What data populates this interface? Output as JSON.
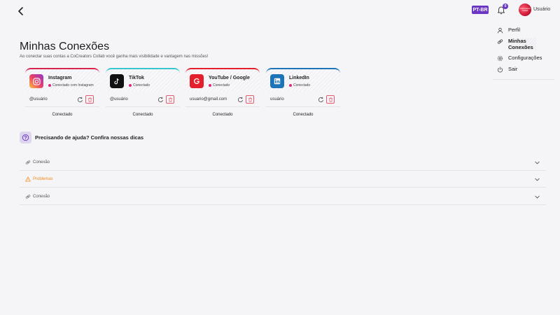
{
  "header": {
    "language": "PT-BR",
    "notifications_count": "0",
    "avatar_text": "CoCreators Collab",
    "user_name": "Usuário"
  },
  "menu": {
    "items": [
      {
        "label": "Perfil",
        "icon": "user-icon"
      },
      {
        "label": "Minhas Conexões",
        "icon": "link-icon"
      },
      {
        "label": "Configurações",
        "icon": "gear-icon"
      },
      {
        "label": "Sair",
        "icon": "power-icon"
      }
    ]
  },
  "page": {
    "title": "Minhas Conexões",
    "subtitle": "Ao conectar suas contas a CoCreators Collab você ganha mais visibilidade e vantagem nas missões!"
  },
  "connections": [
    {
      "name": "Instagram",
      "status": "Conectado com Instagram",
      "handle": "@usuário",
      "label": "Conectado",
      "color": "#d8244c"
    },
    {
      "name": "TikTok",
      "status": "Conectado",
      "handle": "@usuário",
      "label": "Conectado",
      "color": "#38c5cf"
    },
    {
      "name": "YouTube / Google",
      "status": "Conectado",
      "handle": "usuario@gmail.com",
      "label": "Conectado",
      "color": "#e41e2b"
    },
    {
      "name": "LinkedIn",
      "status": "Conectado",
      "handle": "usuário",
      "label": "Conectado",
      "color": "#1d74b6"
    }
  ],
  "help": {
    "title": "Precisando de ajuda? Confira nossas dicas",
    "items": [
      {
        "label": "Conexão",
        "icon": "link-icon"
      },
      {
        "label": "Problemas",
        "icon": "warning-icon"
      },
      {
        "label": "Conexão",
        "icon": "link-icon"
      }
    ]
  },
  "colors": {
    "accent": "#6b36c4",
    "warning": "#ee8c1d",
    "danger": "#e45a6f"
  }
}
